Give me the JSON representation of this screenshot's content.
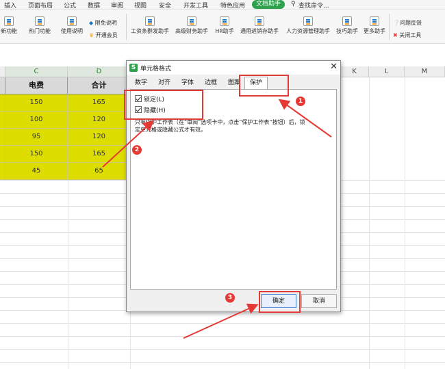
{
  "menubar": {
    "items": [
      "插入",
      "页面布局",
      "公式",
      "数据",
      "审阅",
      "视图",
      "安全",
      "开发工具",
      "特色应用"
    ],
    "active_pill": "文档助手",
    "search": "查找命令..."
  },
  "ribbon": {
    "buttons": [
      "新功能",
      "热门功能",
      "使用说明",
      "工资条群发助手",
      "高级财务助手",
      "HR助手",
      "通用进销存助手",
      "人力资源管理助手",
      "技巧助手",
      "更多助手"
    ],
    "small": {
      "free_note": "限免说明",
      "open_member": "开通会员",
      "feedback": "问题反馈",
      "close_tool": "关闭工具"
    }
  },
  "sheet": {
    "columns": [
      "C",
      "D",
      "K",
      "L",
      "M"
    ],
    "headers": {
      "c": "电费",
      "d": "合计"
    },
    "rows": [
      {
        "c": "150",
        "d": "165"
      },
      {
        "c": "100",
        "d": "120"
      },
      {
        "c": "95",
        "d": "120"
      },
      {
        "c": "150",
        "d": "165"
      },
      {
        "c": "45",
        "d": "65"
      }
    ]
  },
  "dialog": {
    "title": "单元格格式",
    "logo": "S",
    "tabs": [
      "数字",
      "对齐",
      "字体",
      "边框",
      "图案",
      "保护"
    ],
    "active_tab": "保护",
    "checkbox_lock": "锁定(L)",
    "checkbox_hidden": "隐藏(H)",
    "note_line1": "只有保护工作表（在“审阅”选项卡中，点击“保护工作表”按钮）后，锁",
    "note_line2": "定单元格或隐藏公式才有效。",
    "ok": "确定",
    "cancel": "取消"
  },
  "annotations": [
    "1",
    "2",
    "3"
  ],
  "colors": {
    "accent": "#2ea24d",
    "highlight": "#dddd00",
    "annotation": "#e53935"
  }
}
